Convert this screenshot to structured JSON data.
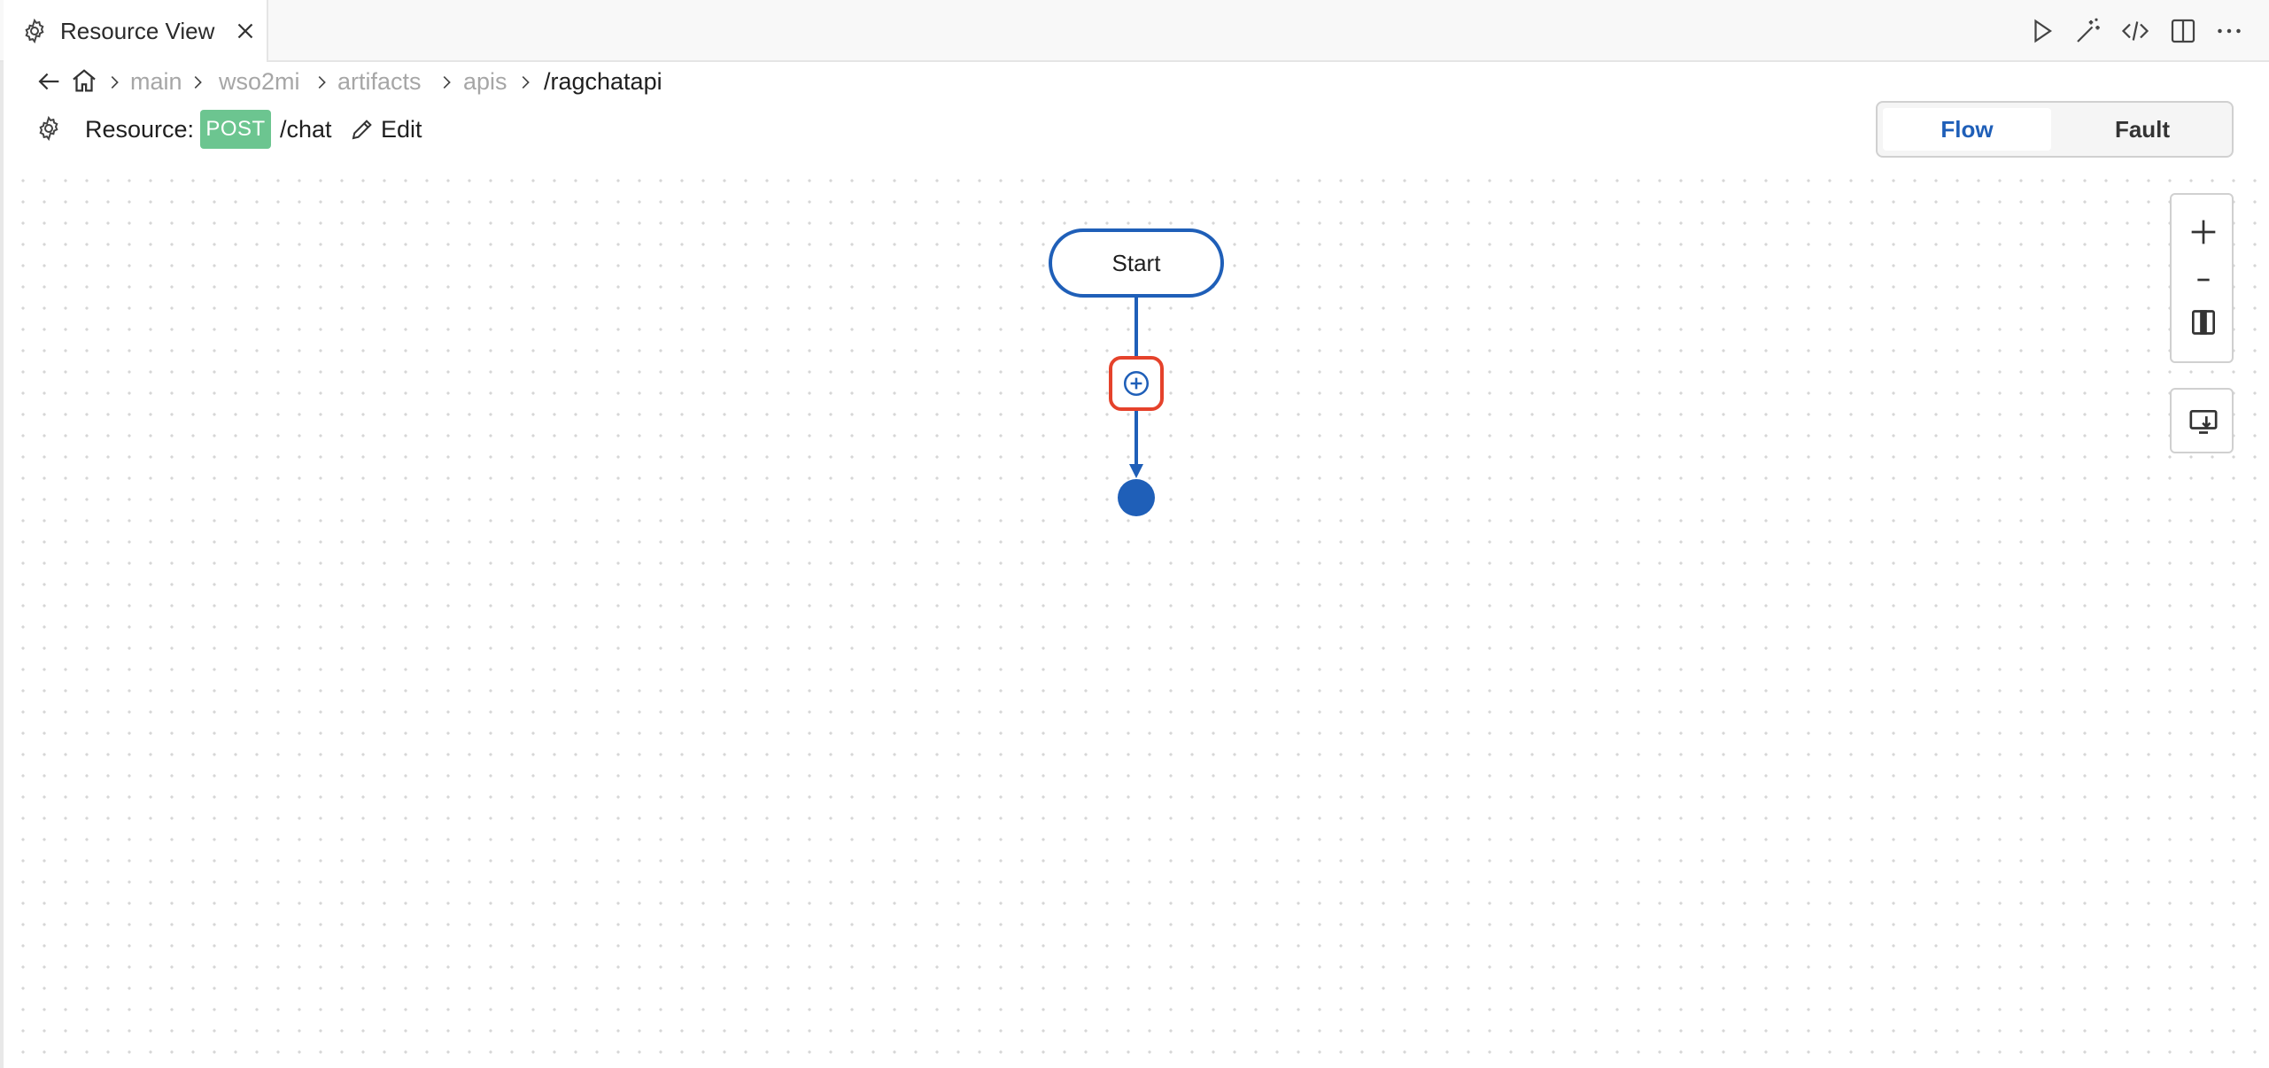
{
  "tab": {
    "title": "Resource View",
    "icon": "gear-icon",
    "close_icon": "close-icon"
  },
  "toolbar": {
    "actions": [
      "run-icon",
      "magic-wand-icon",
      "code-icon",
      "split-editor-icon",
      "more-icon"
    ]
  },
  "breadcrumb": {
    "items": [
      "main",
      "wso2mi",
      "artifacts",
      "apis"
    ],
    "current": "/ragchatapi"
  },
  "resource": {
    "label": "Resource:",
    "method": "POST",
    "path": "/chat",
    "edit_label": "Edit"
  },
  "view_toggle": {
    "options": [
      "Flow",
      "Fault"
    ],
    "selected": "Flow"
  },
  "diagram": {
    "start_label": "Start"
  },
  "colors": {
    "accent_blue": "#1f5fb8",
    "method_post_green": "#6cc590",
    "add_highlight_red": "#e5422b"
  }
}
